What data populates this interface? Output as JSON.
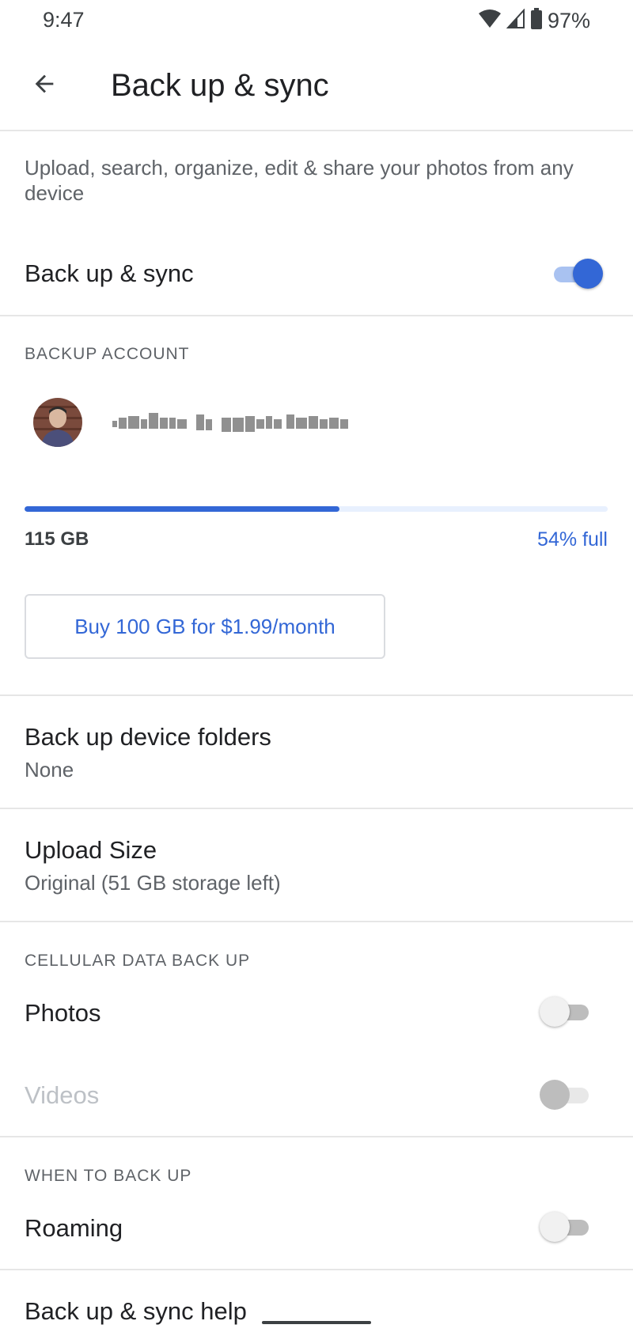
{
  "status_bar": {
    "time": "9:47",
    "battery_percent": "97%",
    "icons": [
      "wifi-icon",
      "cell-signal-icon",
      "battery-icon"
    ]
  },
  "app_bar": {
    "back_icon": "arrow-back-icon",
    "title": "Back up & sync"
  },
  "intro": {
    "description": "Upload, search, organize, edit & share your photos from any device"
  },
  "backup_toggle": {
    "label": "Back up & sync",
    "on": true
  },
  "backup_account": {
    "header": "BACKUP ACCOUNT",
    "storage_used": "115 GB",
    "storage_percent_label": "54% full",
    "usage_fraction": 0.54,
    "buy_button_label": "Buy 100 GB for $1.99/month"
  },
  "device_folders": {
    "label": "Back up device folders",
    "value": "None"
  },
  "upload_size": {
    "label": "Upload Size",
    "value": "Original (51 GB storage left)"
  },
  "cellular": {
    "header": "CELLULAR DATA BACK UP",
    "photos_label": "Photos",
    "photos_on": false,
    "videos_label": "Videos",
    "videos_enabled": false
  },
  "when_to_back_up": {
    "header": "WHEN TO BACK UP",
    "roaming_label": "Roaming",
    "roaming_on": false
  },
  "help": {
    "label": "Back up & sync help"
  },
  "colors": {
    "accent": "#3367d6",
    "track_on": "#a9c2f1",
    "divider": "#e6e6e6",
    "secondary_text": "#5f6368"
  }
}
